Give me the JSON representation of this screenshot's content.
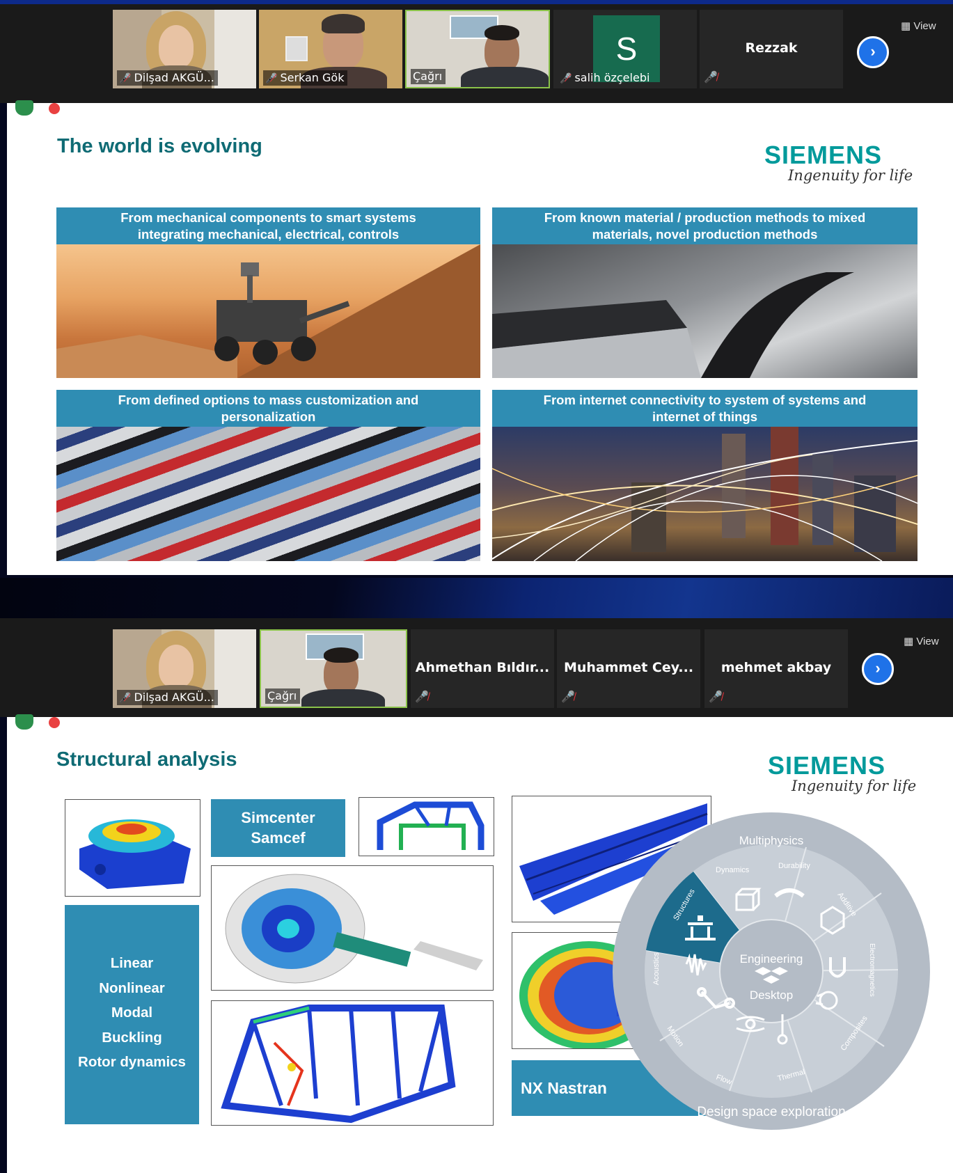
{
  "meeting_view_1": {
    "participants": [
      {
        "name": "Dilşad AKGÜ...",
        "video": true,
        "muted": true
      },
      {
        "name": "Serkan Gök",
        "video": true,
        "muted": true
      },
      {
        "name": "Çağrı",
        "video": true,
        "muted": false
      },
      {
        "name": "salih özçelebi",
        "avatar_letter": "S",
        "muted": true
      },
      {
        "name": "Rezzak",
        "muted": true
      }
    ],
    "view_label": "View"
  },
  "meeting_view_2": {
    "participants": [
      {
        "name": "Dilşad AKGÜ...",
        "video": true,
        "muted": true
      },
      {
        "name": "Çağrı",
        "video": true,
        "muted": false
      },
      {
        "name": "Ahmethan Bıldır...",
        "muted": true
      },
      {
        "name": "Muhammet Cey...",
        "muted": true
      },
      {
        "name": "mehmet akbay",
        "muted": true
      }
    ],
    "view_label": "View"
  },
  "slide1": {
    "title": "The world is evolving",
    "logo": "SIEMENS",
    "tagline": "Ingenuity for life",
    "panels": [
      {
        "line1": "From mechanical components to smart systems",
        "line2": "integrating mechanical, electrical, controls"
      },
      {
        "line1": "From known material / production methods to mixed",
        "line2": "materials, novel production methods"
      },
      {
        "line1": "From defined options to mass customization and",
        "line2": "personalization"
      },
      {
        "line1": "From internet connectivity to system of systems and",
        "line2": "internet of things"
      }
    ]
  },
  "slide2": {
    "title": "Structural analysis",
    "logo": "SIEMENS",
    "tagline": "Ingenuity for life",
    "product1_line1": "Simcenter",
    "product1_line2": "Samcef",
    "analysis_types": [
      "Linear",
      "Nonlinear",
      "Modal",
      "Buckling",
      "Rotor dynamics"
    ],
    "product2": "NX Nastran",
    "wheel": {
      "outer_top": "Multiphysics",
      "outer_bottom": "Design space exploration",
      "center_line1": "Engineering",
      "center_line2": "Desktop",
      "segments": [
        "Structures",
        "Dynamics",
        "Durability",
        "Additive",
        "Electromagnetics",
        "Composites",
        "Thermal",
        "Flow",
        "Motion",
        "Acoustics"
      ]
    }
  },
  "colors": {
    "teal_caption": "#2f8db3",
    "siemens_teal": "#009a9b",
    "title_teal": "#0f6b74",
    "zoom_blue": "#1f72e8",
    "muted_red": "#e0333b"
  }
}
